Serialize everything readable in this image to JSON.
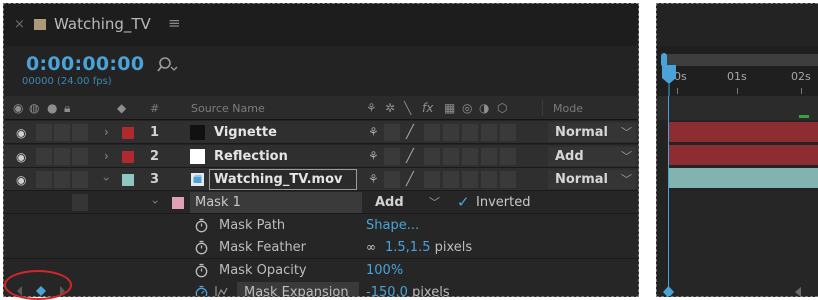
{
  "composition": {
    "tab_close": "×",
    "tab_title": "Watching_TV",
    "tab_menu": "≡",
    "timecode": "0:00:00:00",
    "frames": "00000 (24.00 fps)",
    "search_placeholder": ""
  },
  "columns": {
    "source_name": "Source Name",
    "number": "#",
    "mode": "Mode"
  },
  "layers": [
    {
      "number": "1",
      "name": "Vignette",
      "mode": "Normal",
      "label_color": "#b0292c",
      "thumb_color": "#111111",
      "bar_color": "#8d2d31"
    },
    {
      "number": "2",
      "name": "Reflection",
      "mode": "Add",
      "label_color": "#b0292c",
      "thumb_color": "#ffffff",
      "bar_color": "#8d2d31"
    },
    {
      "number": "3",
      "name": "Watching_TV.mov",
      "mode": "Normal",
      "label_color": "#8fc6c2",
      "thumb_color": "#4aa3d8",
      "bar_color": "#83b3ae"
    }
  ],
  "mask": {
    "name": "Mask 1",
    "mode": "Add",
    "inverted_label": "Inverted",
    "inverted": true,
    "label_color": "#e0a0b8"
  },
  "properties": {
    "mask_path": {
      "label": "Mask Path",
      "value": "Shape..."
    },
    "mask_feather": {
      "label": "Mask Feather",
      "value": "1.5,1.5",
      "unit": "pixels"
    },
    "mask_opacity": {
      "label": "Mask Opacity",
      "value": "100",
      "unit": "%"
    },
    "mask_expansion": {
      "label": "Mask Expansion",
      "value": "-150.0",
      "unit": "pixels"
    }
  },
  "timeline": {
    "ticks": [
      "00s",
      "01s",
      "02s"
    ]
  },
  "accent_color": "#4aa3d8",
  "annotation_color": "#d2262a"
}
